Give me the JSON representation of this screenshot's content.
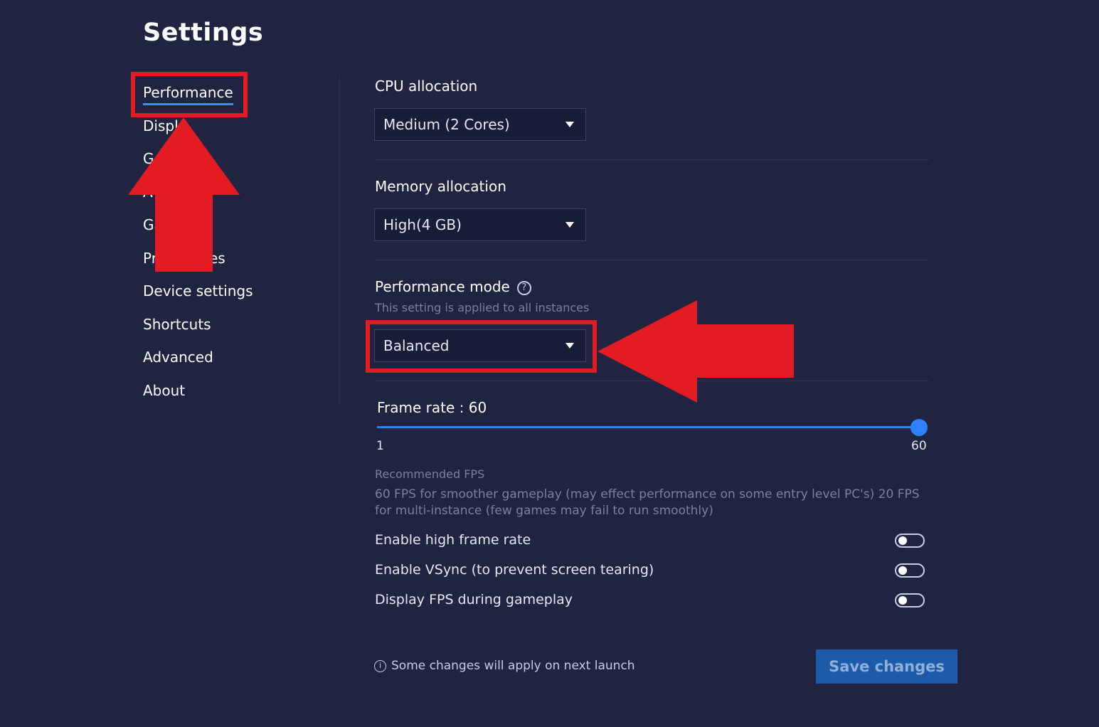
{
  "page": {
    "title": "Settings"
  },
  "sidebar": {
    "items": [
      {
        "label": "Performance",
        "active": true
      },
      {
        "label": "Displ"
      },
      {
        "label": "G"
      },
      {
        "label": "A"
      },
      {
        "label": "Ga"
      },
      {
        "label": "Pr",
        "label_end": "es"
      },
      {
        "label": "Device settings"
      },
      {
        "label": "Shortcuts"
      },
      {
        "label": "Advanced"
      },
      {
        "label": "About"
      }
    ]
  },
  "cpu": {
    "label": "CPU allocation",
    "value": "Medium (2 Cores)"
  },
  "memory": {
    "label": "Memory allocation",
    "value": "High(4 GB)"
  },
  "perf_mode": {
    "label": "Performance mode",
    "help_icon": "?",
    "sublabel": "This setting is applied to all instances",
    "value": "Balanced"
  },
  "frame_rate": {
    "label": "Frame rate : 60",
    "value": 60,
    "min_label": "1",
    "max_label": "60",
    "recommended_title": "Recommended FPS",
    "recommended_text": "60 FPS for smoother gameplay (may effect performance on some entry level PC's) 20 FPS for multi-instance (few games may fail to run smoothly)"
  },
  "toggles": [
    {
      "label": "Enable high frame rate",
      "on": false
    },
    {
      "label": "Enable VSync (to prevent screen tearing)",
      "on": false
    },
    {
      "label": "Display FPS during gameplay",
      "on": false
    }
  ],
  "footer": {
    "info_icon": "i",
    "note": "Some changes will apply on next launch",
    "save_label": "Save changes"
  },
  "colors": {
    "background": "#212441",
    "accent": "#2f80ff",
    "annotation_red": "#e31b23"
  }
}
